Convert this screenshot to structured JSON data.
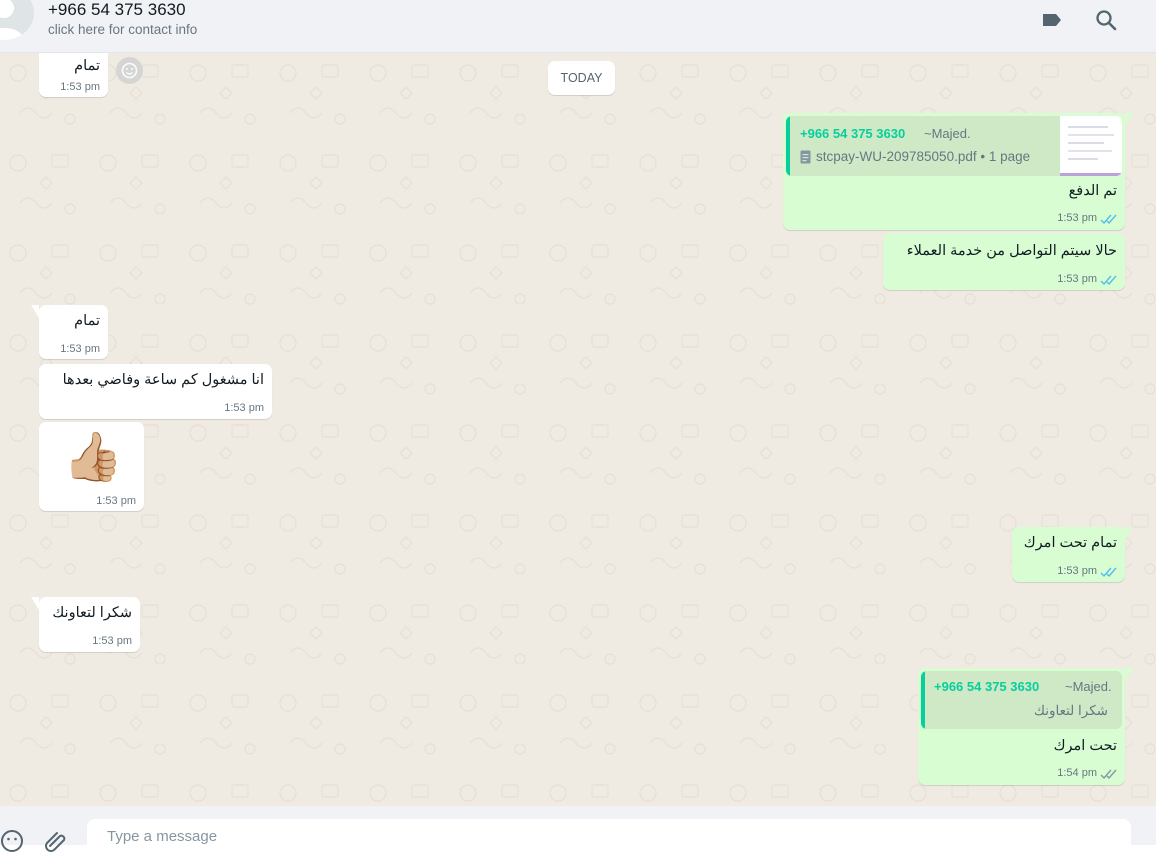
{
  "header": {
    "contact_name": "+966 54 375 3630",
    "contact_subtitle": "click here for contact info"
  },
  "day_chip": "TODAY",
  "messages": [
    {
      "direction": "in",
      "text": "تمام",
      "time": "1:53 pm"
    },
    {
      "direction": "out",
      "quote": {
        "sender": "+966 54 375 3630",
        "alias": "~Majed.",
        "doc_name": "stcpay-WU-209785050.pdf • 1 page"
      },
      "text": "تم الدفع",
      "time": "1:53 pm"
    },
    {
      "direction": "out",
      "text": "حالا سيتم التواصل من خدمة العملاء",
      "time": "1:53 pm"
    },
    {
      "direction": "in",
      "text": "تمام",
      "time": "1:53 pm"
    },
    {
      "direction": "in",
      "text": "انا مشغول كم ساعة وفاضي بعدها",
      "time": "1:53 pm"
    },
    {
      "direction": "in",
      "emoji": "👍🏼",
      "time": "1:53 pm"
    },
    {
      "direction": "out",
      "text": "تمام تحت امرك",
      "time": "1:53 pm"
    },
    {
      "direction": "in",
      "text": "شكرا لتعاونك",
      "time": "1:53 pm"
    },
    {
      "direction": "out",
      "quote": {
        "sender": "+966 54 375 3630",
        "alias": "~Majed.",
        "text": "شكرا لتعاونك"
      },
      "text": "تحت امرك",
      "time": "1:54 pm"
    }
  ],
  "composer": {
    "placeholder": "Type a message"
  },
  "colors": {
    "incoming": "#ffffff",
    "outgoing": "#d9fdd3",
    "accent": "#06cf9c",
    "read_ticks": "#53bdeb"
  },
  "icons": [
    "default-avatar-icon",
    "label-icon",
    "search-icon",
    "emoji-icon",
    "attach-icon",
    "read-ticks-icon",
    "reaction-emoji-icon",
    "pdf-doc-icon"
  ]
}
